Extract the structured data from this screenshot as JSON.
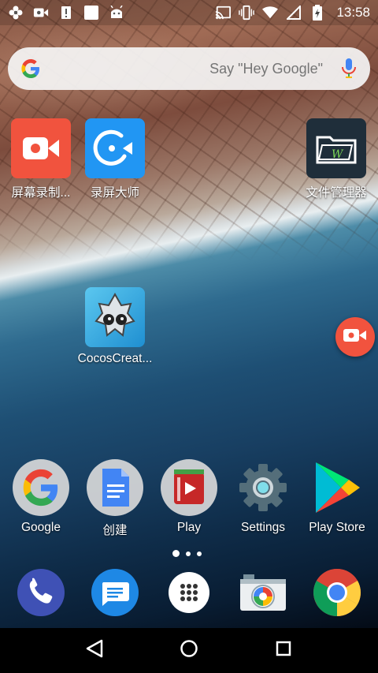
{
  "status_bar": {
    "time": "13:58",
    "left_icons": [
      "settings-flower-icon",
      "video-camera-icon",
      "alert-icon",
      "white-square-icon",
      "android-icon"
    ],
    "right_icons": [
      "cast-icon",
      "vibrate-icon",
      "wifi-icon",
      "cellular-icon",
      "battery-charging-icon"
    ]
  },
  "search": {
    "placeholder": "Say \"Hey Google\""
  },
  "home_apps": [
    {
      "label": "屏幕录制..."
    },
    {
      "label": "录屏大师"
    },
    {
      "label": "文件管理器"
    },
    {
      "label": "CocosCreat..."
    }
  ],
  "row_apps": [
    {
      "label": "Google"
    },
    {
      "label": "创建"
    },
    {
      "label": "Play"
    },
    {
      "label": "Settings"
    },
    {
      "label": "Play Store"
    }
  ],
  "dock": [
    "phone-icon",
    "messages-icon",
    "app-drawer-icon",
    "camera-icon",
    "chrome-icon"
  ],
  "colors": {
    "record_red": "#f1533e",
    "blue_app": "#2196f3",
    "phone_blue": "#3f51b5",
    "messages_blue": "#1e88e5"
  }
}
